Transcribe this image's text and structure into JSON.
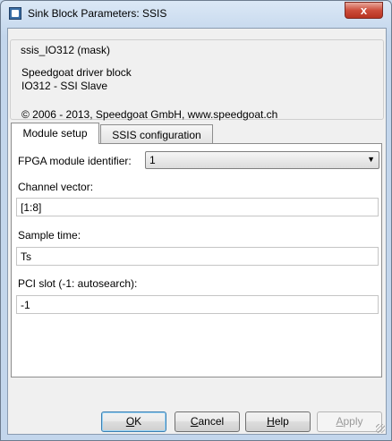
{
  "window": {
    "title": "Sink Block Parameters: SSIS",
    "close_glyph": "x"
  },
  "mask": {
    "legend": "ssis_IO312 (mask)",
    "description_line1": "Speedgoat driver block",
    "description_line2": "IO312 - SSI Slave",
    "copyright": "© 2006 - 2013, Speedgoat GmbH, www.speedgoat.ch"
  },
  "tabs": [
    {
      "label": "Module setup",
      "active": true
    },
    {
      "label": "SSIS configuration",
      "active": false
    }
  ],
  "params": {
    "fpga_label": "FPGA module identifier:",
    "fpga_value": "1",
    "channel_label": "Channel vector:",
    "channel_value": "[1:8]",
    "sample_label": "Sample time:",
    "sample_value": "Ts",
    "pci_label": "PCI slot (-1: autosearch):",
    "pci_value": "-1"
  },
  "buttons": {
    "ok": {
      "mnemonic": "O",
      "rest": "K"
    },
    "cancel": {
      "mnemonic": "C",
      "rest": "ancel"
    },
    "help": {
      "mnemonic": "H",
      "rest": "elp"
    },
    "apply": {
      "mnemonic": "A",
      "rest": "pply",
      "enabled": false
    }
  }
}
